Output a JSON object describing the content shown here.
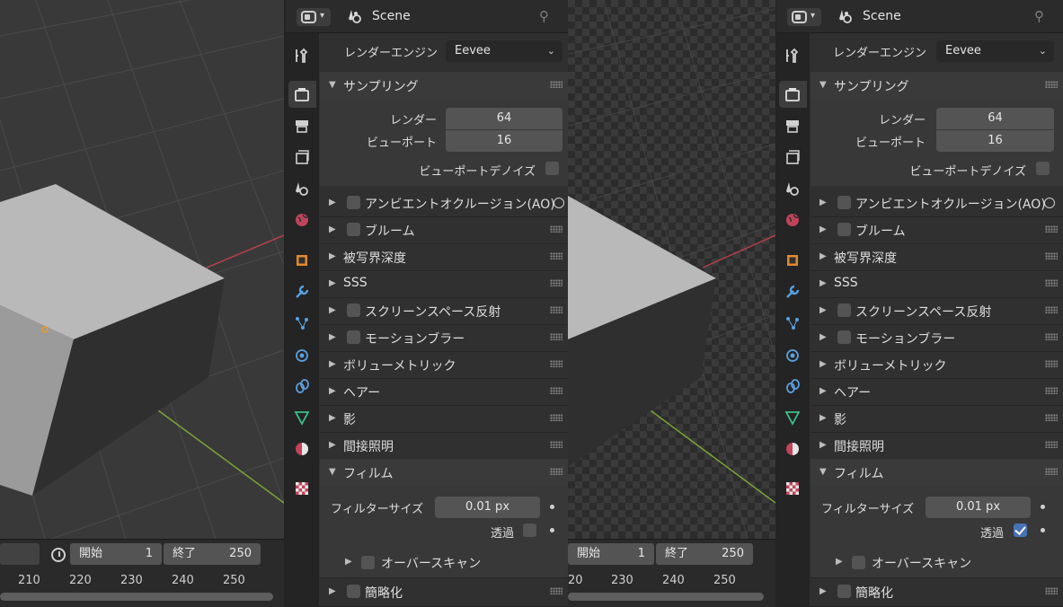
{
  "scene_name": "Scene",
  "labels": {
    "render_engine": "レンダーエンジン",
    "engine_value": "Eevee",
    "sampling": "サンプリング",
    "render": "レンダー",
    "render_samples": "64",
    "viewport": "ビューポート",
    "viewport_samples": "16",
    "viewport_denoise": "ビューポートデノイズ",
    "ao": "アンビエントオクルージョン(AO)",
    "bloom": "ブルーム",
    "dof": "被写界深度",
    "sss": "SSS",
    "ssr": "スクリーンスペース反射",
    "motion_blur": "モーションブラー",
    "volumetrics": "ボリューメトリック",
    "hair": "ヘアー",
    "shadows": "影",
    "indirect": "間接照明",
    "film": "フィルム",
    "filter_size": "フィルターサイズ",
    "filter_value": "0.01 px",
    "transparent": "透過",
    "overscan": "オーバースキャン",
    "simplify": "簡略化"
  },
  "timeline": {
    "start_label": "開始",
    "start_value": "1",
    "end_label": "終了",
    "end_value": "250",
    "ticks_left": [
      "210",
      "220",
      "230",
      "240",
      "250"
    ],
    "ticks_right": [
      "20",
      "230",
      "240",
      "250"
    ]
  },
  "panels": [
    {
      "transparent_checked": false
    },
    {
      "transparent_checked": true
    }
  ],
  "colors": {
    "accent": "#4772b3",
    "x_axis": "#b4424a",
    "y_axis": "#7aa53a"
  }
}
